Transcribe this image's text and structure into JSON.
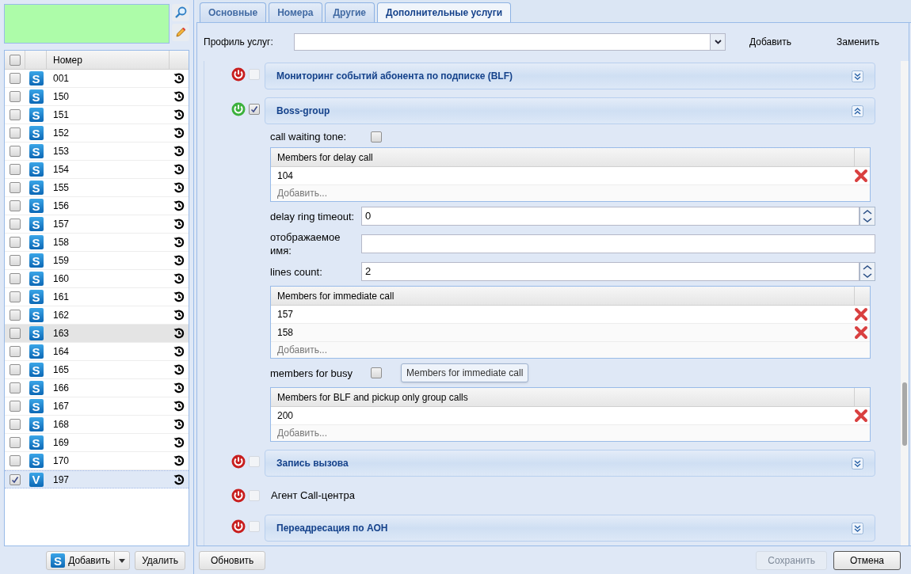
{
  "left_panel": {
    "table": {
      "columns": [
        "Номер"
      ],
      "header_checked": false,
      "rows": [
        {
          "letter": "S",
          "number": "001",
          "checked": false,
          "selected": false,
          "hovered": false
        },
        {
          "letter": "S",
          "number": "150",
          "checked": false,
          "selected": false,
          "hovered": false
        },
        {
          "letter": "S",
          "number": "151",
          "checked": false,
          "selected": false,
          "hovered": false
        },
        {
          "letter": "S",
          "number": "152",
          "checked": false,
          "selected": false,
          "hovered": false
        },
        {
          "letter": "S",
          "number": "153",
          "checked": false,
          "selected": false,
          "hovered": false
        },
        {
          "letter": "S",
          "number": "154",
          "checked": false,
          "selected": false,
          "hovered": false
        },
        {
          "letter": "S",
          "number": "155",
          "checked": false,
          "selected": false,
          "hovered": false
        },
        {
          "letter": "S",
          "number": "156",
          "checked": false,
          "selected": false,
          "hovered": false
        },
        {
          "letter": "S",
          "number": "157",
          "checked": false,
          "selected": false,
          "hovered": false
        },
        {
          "letter": "S",
          "number": "158",
          "checked": false,
          "selected": false,
          "hovered": false
        },
        {
          "letter": "S",
          "number": "159",
          "checked": false,
          "selected": false,
          "hovered": false
        },
        {
          "letter": "S",
          "number": "160",
          "checked": false,
          "selected": false,
          "hovered": false
        },
        {
          "letter": "S",
          "number": "161",
          "checked": false,
          "selected": false,
          "hovered": false
        },
        {
          "letter": "S",
          "number": "162",
          "checked": false,
          "selected": false,
          "hovered": false
        },
        {
          "letter": "S",
          "number": "163",
          "checked": false,
          "selected": false,
          "hovered": true
        },
        {
          "letter": "S",
          "number": "164",
          "checked": false,
          "selected": false,
          "hovered": false
        },
        {
          "letter": "S",
          "number": "165",
          "checked": false,
          "selected": false,
          "hovered": false
        },
        {
          "letter": "S",
          "number": "166",
          "checked": false,
          "selected": false,
          "hovered": false
        },
        {
          "letter": "S",
          "number": "167",
          "checked": false,
          "selected": false,
          "hovered": false
        },
        {
          "letter": "S",
          "number": "168",
          "checked": false,
          "selected": false,
          "hovered": false
        },
        {
          "letter": "S",
          "number": "169",
          "checked": false,
          "selected": false,
          "hovered": false
        },
        {
          "letter": "S",
          "number": "170",
          "checked": false,
          "selected": false,
          "hovered": false
        },
        {
          "letter": "V",
          "number": "197",
          "checked": true,
          "selected": true,
          "hovered": false
        }
      ]
    },
    "add_button": {
      "letter": "S",
      "label": "Добавить"
    },
    "delete_button": "Удалить"
  },
  "tabs": [
    {
      "label": "Основные",
      "selected": false
    },
    {
      "label": "Номера",
      "selected": false
    },
    {
      "label": "Другие",
      "selected": false
    },
    {
      "label": "Дополнительные услуги",
      "selected": true
    }
  ],
  "profile": {
    "label": "Профиль услуг:",
    "add": "Добавить",
    "replace": "Заменить"
  },
  "services": [
    {
      "kind": "panel",
      "title": "Мониторинг событий абонента по подписке (BLF)",
      "on": false,
      "checked": false,
      "expanded": false
    },
    {
      "kind": "panel",
      "title": "Boss-group",
      "on": true,
      "checked": true,
      "expanded": true,
      "fields": [
        {
          "kind": "checkbox",
          "label": "call waiting tone:",
          "checked": false
        },
        {
          "kind": "grid",
          "header": "Members for delay call",
          "rows": [
            "104"
          ],
          "add": "Добавить..."
        },
        {
          "kind": "spinner",
          "label": "delay ring timeout:",
          "value": "0"
        },
        {
          "kind": "text",
          "label": "отображаемое имя:"
        },
        {
          "kind": "spinner",
          "label": "lines count:",
          "value": "2"
        },
        {
          "kind": "grid",
          "header": "Members for immediate call",
          "rows": [
            "157",
            "158"
          ],
          "add": "Добавить..."
        },
        {
          "kind": "checkbox",
          "label": "members for busy",
          "checked": false,
          "tooltip": "Members for immediate call"
        },
        {
          "kind": "grid",
          "header": "Members for BLF and pickup only group calls",
          "rows": [
            "200"
          ],
          "add": "Добавить..."
        }
      ]
    },
    {
      "kind": "panel",
      "title": "Запись вызова",
      "on": false,
      "checked": false,
      "expanded": false
    },
    {
      "kind": "plain",
      "title": "Агент Call-центра",
      "on": false,
      "checked": false
    },
    {
      "kind": "panel",
      "title": "Переадресация по АОН",
      "on": false,
      "checked": false,
      "expanded": false
    }
  ],
  "footer": {
    "refresh": "Обновить",
    "save": "Сохранить",
    "save_disabled": true,
    "cancel": "Отмена"
  }
}
